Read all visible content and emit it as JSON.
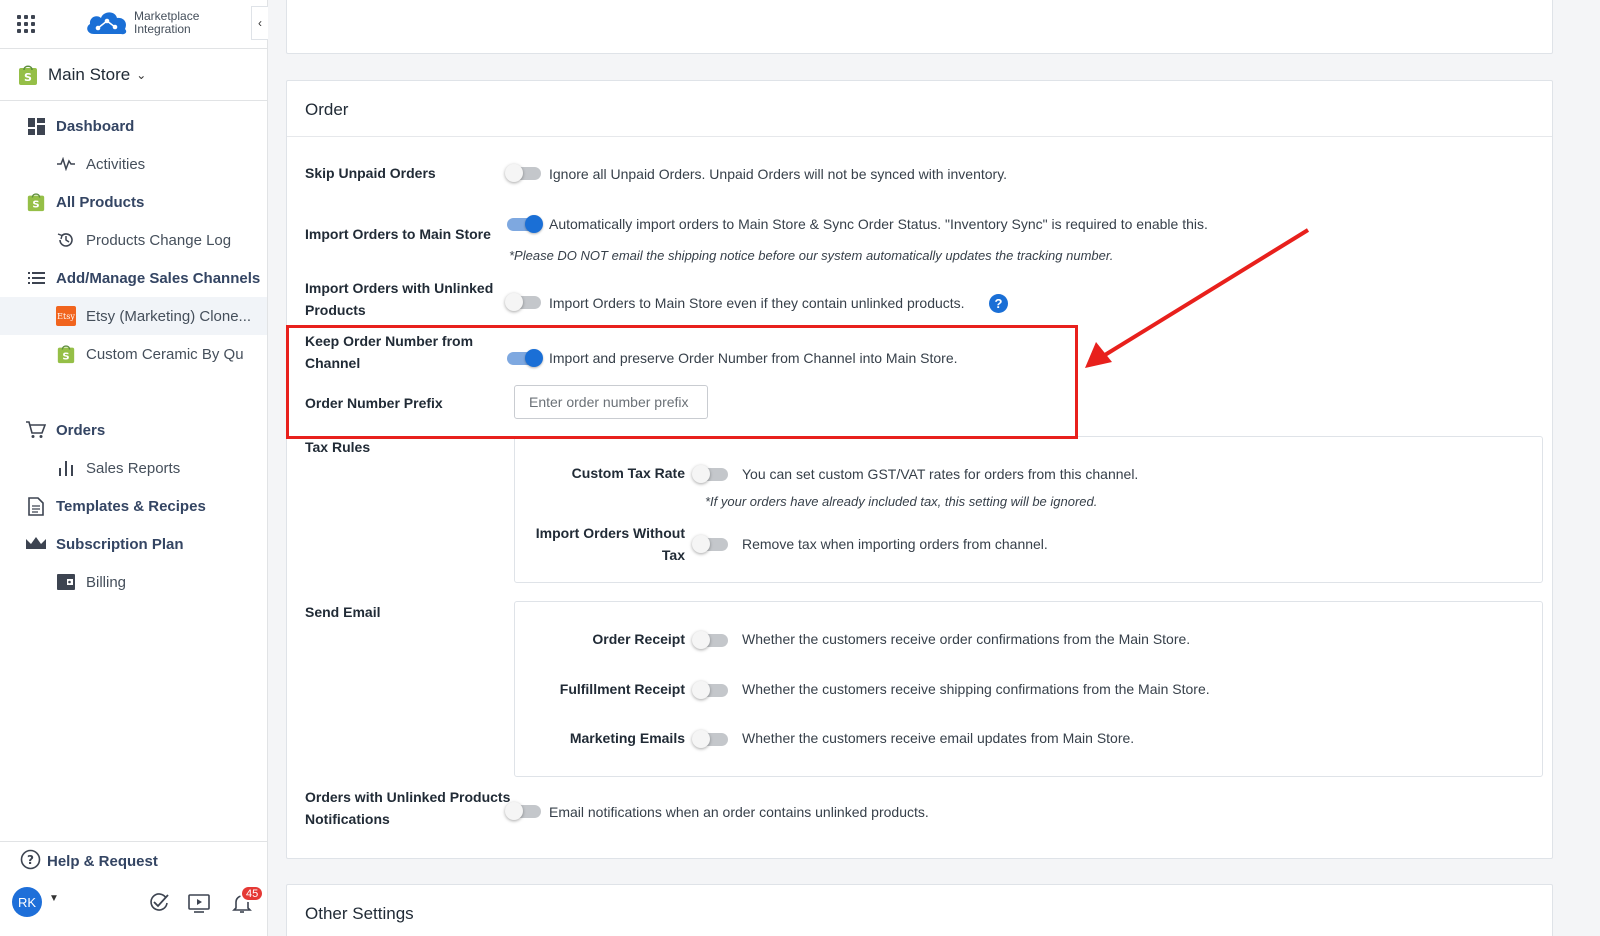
{
  "app": {
    "logo_line1": "Marketplace",
    "logo_line2": "Integration"
  },
  "store": {
    "name": "Main Store"
  },
  "nav": {
    "dashboard": "Dashboard",
    "activities": "Activities",
    "all_products": "All Products",
    "products_change_log": "Products Change Log",
    "add_manage_sales_channels": "Add/Manage Sales Channels",
    "etsy_channel": "Etsy (Marketing) Clone...",
    "etsy_badge": "Etsy",
    "custom_ceramic": "Custom Ceramic By Qu",
    "orders": "Orders",
    "sales_reports": "Sales Reports",
    "templates_recipes": "Templates & Recipes",
    "subscription_plan": "Subscription Plan",
    "billing": "Billing"
  },
  "footer": {
    "help": "Help & Request",
    "avatar_initials": "RK",
    "notification_count": "45"
  },
  "order_section": {
    "title": "Order",
    "skip_unpaid": {
      "label": "Skip Unpaid Orders",
      "desc": "Ignore all Unpaid Orders. Unpaid Orders will not be synced with inventory.",
      "on": false
    },
    "import_orders": {
      "label": "Import Orders to Main Store",
      "desc": "Automatically import orders to Main Store & Sync Order Status. \"Inventory Sync\" is required to enable this.",
      "note": "*Please DO NOT email the shipping notice before our system automatically updates the tracking number.",
      "on": true
    },
    "import_unlinked": {
      "label_line1": "Import Orders with Unlinked",
      "label_line2": "Products",
      "desc": "Import Orders to Main Store even if they contain unlinked products.",
      "help": "?",
      "on": false
    },
    "keep_order_number": {
      "label_line1": "Keep Order Number from",
      "label_line2": "Channel",
      "desc": "Import and preserve Order Number from Channel into Main Store.",
      "on": true
    },
    "order_number_prefix": {
      "label": "Order Number Prefix",
      "placeholder": "Enter order number prefix"
    },
    "tax_rules": {
      "label": "Tax Rules",
      "custom_tax_rate": {
        "label": "Custom Tax Rate",
        "desc": "You can set custom GST/VAT rates for orders from this channel.",
        "note": "*If your orders have already included tax, this setting will be ignored.",
        "on": false
      },
      "import_without_tax": {
        "label_line1": "Import Orders Without",
        "label_line2": "Tax",
        "desc": "Remove tax when importing orders from channel.",
        "on": false
      }
    },
    "send_email": {
      "label": "Send Email",
      "order_receipt": {
        "label": "Order Receipt",
        "desc": "Whether the customers receive order confirmations from the Main Store.",
        "on": false
      },
      "fulfillment_receipt": {
        "label": "Fulfillment Receipt",
        "desc": "Whether the customers receive shipping confirmations from the Main Store.",
        "on": false
      },
      "marketing_emails": {
        "label": "Marketing Emails",
        "desc": "Whether the customers receive email updates from Main Store.",
        "on": false
      }
    },
    "unlinked_notifications": {
      "label_line1": "Orders with Unlinked Products",
      "label_line2": "Notifications",
      "desc": "Email notifications when an order contains unlinked products.",
      "on": false
    }
  },
  "other_settings": {
    "title": "Other Settings"
  },
  "colors": {
    "accent": "#1a6fd6",
    "highlight": "#e8201c",
    "etsy": "#f1641e",
    "shopify_green": "#95bf47"
  }
}
